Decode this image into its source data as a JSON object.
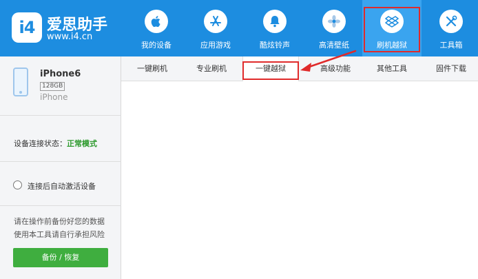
{
  "app": {
    "logo_mark": "i4",
    "logo_title": "爱思助手",
    "logo_url": "www.i4.cn"
  },
  "nav": [
    {
      "label": "我的设备",
      "icon": "apple-icon"
    },
    {
      "label": "应用游戏",
      "icon": "app-store-icon"
    },
    {
      "label": "酷炫铃声",
      "icon": "bell-icon"
    },
    {
      "label": "高清壁纸",
      "icon": "flower-icon"
    },
    {
      "label": "刷机越狱",
      "icon": "dropbox-icon",
      "active": true
    },
    {
      "label": "工具箱",
      "icon": "tools-icon"
    }
  ],
  "device": {
    "name": "iPhone6",
    "capacity": "128GB",
    "model": "iPhone"
  },
  "status": {
    "label": "设备连接状态：",
    "value": "正常模式"
  },
  "auto_activate": {
    "label": "连接后自动激活设备",
    "checked": false
  },
  "backup": {
    "note_line1": "请在操作前备份好您的数据",
    "note_line2": "使用本工具请自行承担风险",
    "button_label": "备份 / 恢复"
  },
  "tabs": [
    {
      "label": "一键刷机"
    },
    {
      "label": "专业刷机"
    },
    {
      "label": "一键越狱",
      "active": true
    },
    {
      "label": "高级功能"
    },
    {
      "label": "其他工具"
    },
    {
      "label": "固件下载"
    }
  ],
  "colors": {
    "header_blue": "#1d8de0",
    "active_nav": "#3aa4ef",
    "status_green": "#2e9a2e",
    "button_green": "#3fae3f",
    "annotation_red": "#e02a2a"
  }
}
